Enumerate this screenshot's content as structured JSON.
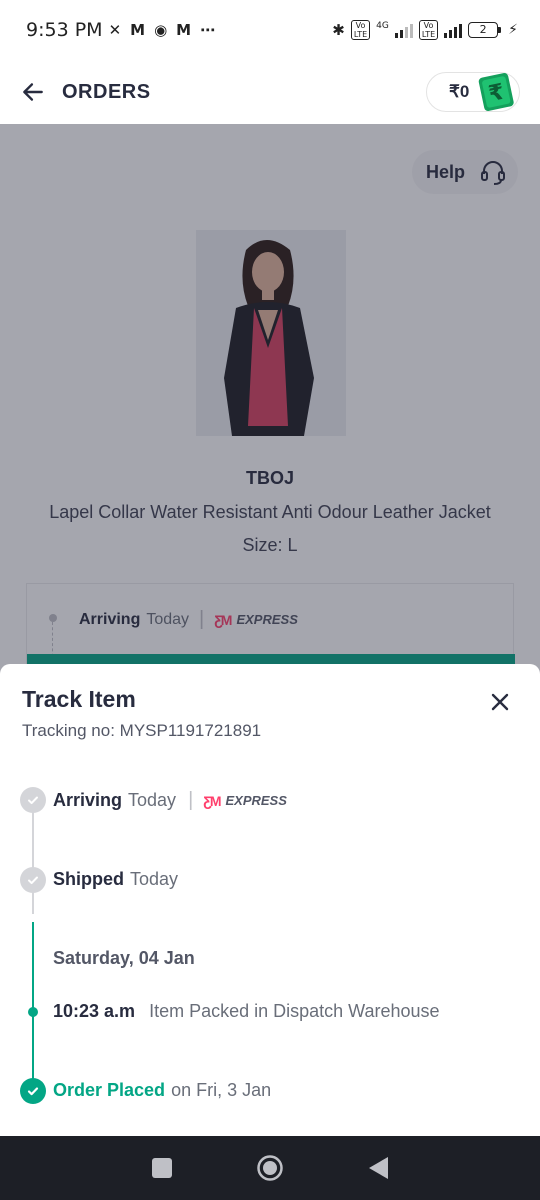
{
  "status_bar": {
    "time": "9:53 PM",
    "left_icons": [
      "no-call-icon",
      "myntra-icon",
      "messenger-icon",
      "myntra-icon",
      "more-icon"
    ],
    "network": "4G",
    "battery": "2"
  },
  "header": {
    "title": "ORDERS",
    "wallet_amount": "₹0"
  },
  "page": {
    "help_label": "Help",
    "brand": "TBOJ",
    "product_name": "Lapel Collar Water Resistant Anti Odour Leather Jacket",
    "size": "Size: L",
    "status_card": {
      "label": "Arriving",
      "when": "Today",
      "courier": "EXPRESS"
    }
  },
  "sheet": {
    "title": "Track Item",
    "tracking_label": "Tracking no:",
    "tracking_number": "MYSP1191721891",
    "steps": [
      {
        "label": "Arriving",
        "detail": "Today",
        "courier": "EXPRESS",
        "state": "pending"
      },
      {
        "label": "Shipped",
        "detail": "Today",
        "state": "pending"
      },
      {
        "date": "Saturday, 04 Jan"
      },
      {
        "time": "10:23 a.m",
        "detail": "Item Packed in Dispatch Warehouse",
        "state": "done"
      },
      {
        "label": "Order Placed",
        "detail": "on Fri, 3 Jan",
        "state": "done"
      }
    ]
  },
  "colors": {
    "accent_green": "#03a685",
    "brand_pink": "#ff3f6c",
    "text_dark": "#282c3f",
    "text_muted": "#696e79",
    "navbar": "#1d1f26"
  }
}
